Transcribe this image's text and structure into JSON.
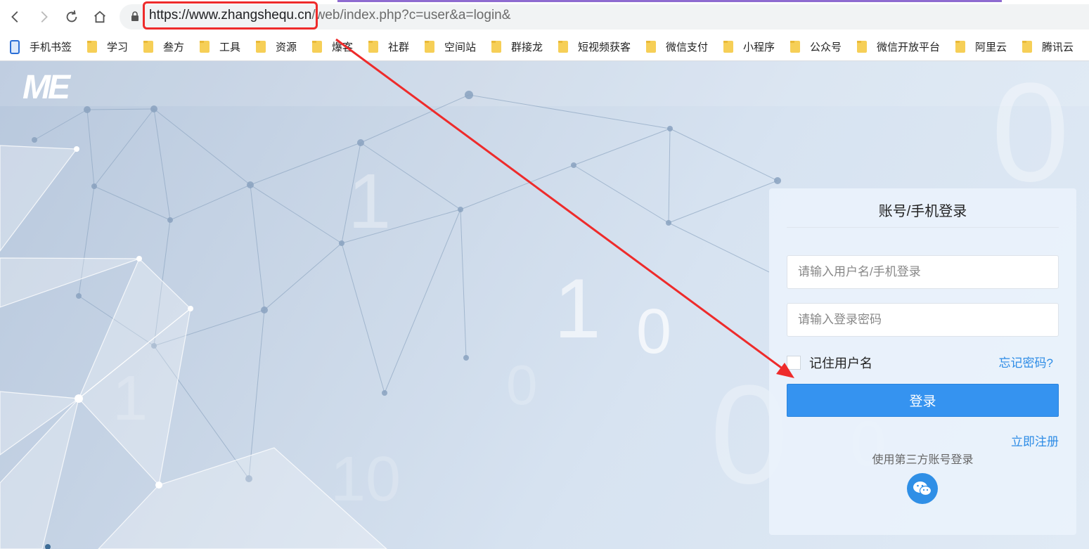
{
  "browser": {
    "url_highlight": "https://www.zhangshequ.cn",
    "url_rest": "/web/index.php?c=user&a=login&"
  },
  "bookmarks": [
    {
      "label": "手机书签",
      "icon": "mobile-bookmark-icon"
    },
    {
      "label": "学习",
      "icon": "folder-icon"
    },
    {
      "label": "叁方",
      "icon": "folder-icon"
    },
    {
      "label": "工具",
      "icon": "folder-icon"
    },
    {
      "label": "资源",
      "icon": "folder-icon"
    },
    {
      "label": "爆客",
      "icon": "folder-icon"
    },
    {
      "label": "社群",
      "icon": "folder-icon"
    },
    {
      "label": "空间站",
      "icon": "folder-icon"
    },
    {
      "label": "群接龙",
      "icon": "folder-icon"
    },
    {
      "label": "短视频获客",
      "icon": "folder-icon"
    },
    {
      "label": "微信支付",
      "icon": "folder-icon"
    },
    {
      "label": "小程序",
      "icon": "folder-icon"
    },
    {
      "label": "公众号",
      "icon": "folder-icon"
    },
    {
      "label": "微信开放平台",
      "icon": "folder-icon"
    },
    {
      "label": "阿里云",
      "icon": "folder-icon"
    },
    {
      "label": "腾讯云",
      "icon": "folder-icon"
    }
  ],
  "logo": {
    "text": "ME"
  },
  "login": {
    "title": "账号/手机登录",
    "username_placeholder": "请输入用户名/手机登录",
    "password_placeholder": "请输入登录密码",
    "remember_label": "记住用户名",
    "forgot_label": "忘记密码?",
    "submit_label": "登录",
    "register_label": "立即注册",
    "third_party_label": "使用第三方账号登录"
  },
  "colors": {
    "accent": "#3593f0",
    "link": "#2d8ce6",
    "highlight_box": "#ee2b2b"
  }
}
